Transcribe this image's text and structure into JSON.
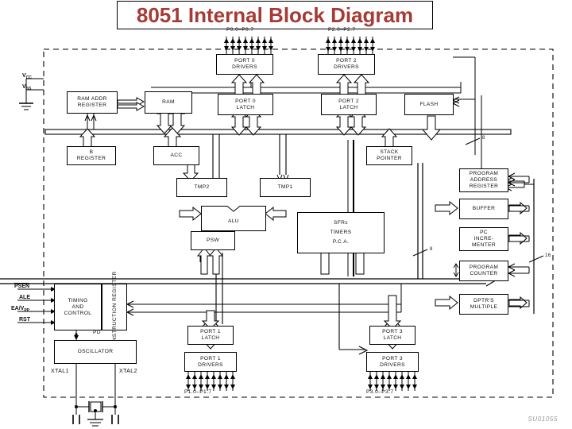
{
  "title": "8051 Internal Block Diagram",
  "watermark": "SU01055",
  "colors": {
    "title": "#a63a35",
    "line": "#000000",
    "background": "#ffffff",
    "watermark": "#9a9a9a"
  },
  "port_pin_labels": {
    "p0": "P0.0–P0.7",
    "p2": "P2.0–P2.7",
    "p1": "P1.0–P1.7",
    "p3": "P3.0–P3.7"
  },
  "power_pins": {
    "vcc": "V",
    "vcc_sub": "CC",
    "vss": "V",
    "vss_sub": "SS"
  },
  "control_pins": [
    {
      "name": "PSEN",
      "overbar": true
    },
    {
      "name": "ALE",
      "overbar": false
    },
    {
      "name": "EA/V",
      "sub": "PP",
      "overbar": false
    },
    {
      "name": "RST",
      "overbar": false
    }
  ],
  "crystal_pins": {
    "left": "XTAL1",
    "right": "XTAL2"
  },
  "bus_width_labels": {
    "flash_bus": "8",
    "right_bus": "16",
    "mid_bus": "8"
  },
  "power_down_label": "PD",
  "blocks": [
    {
      "id": "port0-drivers",
      "lines": [
        "PORT 0",
        "DRIVERS"
      ]
    },
    {
      "id": "port2-drivers",
      "lines": [
        "PORT 2",
        "DRIVERS"
      ]
    },
    {
      "id": "ram-addr-reg",
      "lines": [
        "RAM ADDR",
        "REGISTER"
      ]
    },
    {
      "id": "ram",
      "lines": [
        "RAM"
      ]
    },
    {
      "id": "port0-latch",
      "lines": [
        "PORT 0",
        "LATCH"
      ]
    },
    {
      "id": "port2-latch",
      "lines": [
        "PORT 2",
        "LATCH"
      ]
    },
    {
      "id": "flash",
      "lines": [
        "FLASH"
      ]
    },
    {
      "id": "b-register",
      "lines": [
        "B",
        "REGISTER"
      ]
    },
    {
      "id": "acc",
      "lines": [
        "ACC"
      ]
    },
    {
      "id": "stack-pointer",
      "lines": [
        "STACK",
        "POINTER"
      ]
    },
    {
      "id": "tmp2",
      "lines": [
        "TMP2"
      ]
    },
    {
      "id": "tmp1",
      "lines": [
        "TMP1"
      ]
    },
    {
      "id": "alu",
      "lines": [
        "ALU"
      ]
    },
    {
      "id": "psw",
      "lines": [
        "PSW"
      ]
    },
    {
      "id": "sfrs",
      "lines": [
        "SFRs",
        "TIMERS",
        "P.C.A."
      ]
    },
    {
      "id": "prog-addr-reg",
      "lines": [
        "PROGRAM",
        "ADDRESS",
        "REGISTER"
      ]
    },
    {
      "id": "buffer",
      "lines": [
        "BUFFER"
      ]
    },
    {
      "id": "pc-incrementer",
      "lines": [
        "PC",
        "INCRE-",
        "MENTER"
      ]
    },
    {
      "id": "program-counter",
      "lines": [
        "PROGRAM",
        "COUNTER"
      ]
    },
    {
      "id": "dptr-multiple",
      "lines": [
        "DPTR'S",
        "MULTIPLE"
      ]
    },
    {
      "id": "timing-control",
      "lines": [
        "TIMING",
        "AND",
        "CONTROL"
      ]
    },
    {
      "id": "instruction-reg",
      "lines": [
        "INSTRUCTION REGISTER"
      ]
    },
    {
      "id": "oscillator",
      "lines": [
        "OSCILLATOR"
      ]
    },
    {
      "id": "port1-latch",
      "lines": [
        "PORT 1",
        "LATCH"
      ]
    },
    {
      "id": "port1-drivers",
      "lines": [
        "PORT 1",
        "DRIVERS"
      ]
    },
    {
      "id": "port3-latch",
      "lines": [
        "PORT 3",
        "LATCH"
      ]
    },
    {
      "id": "port3-drivers",
      "lines": [
        "PORT 3",
        "DRIVERS"
      ]
    }
  ]
}
